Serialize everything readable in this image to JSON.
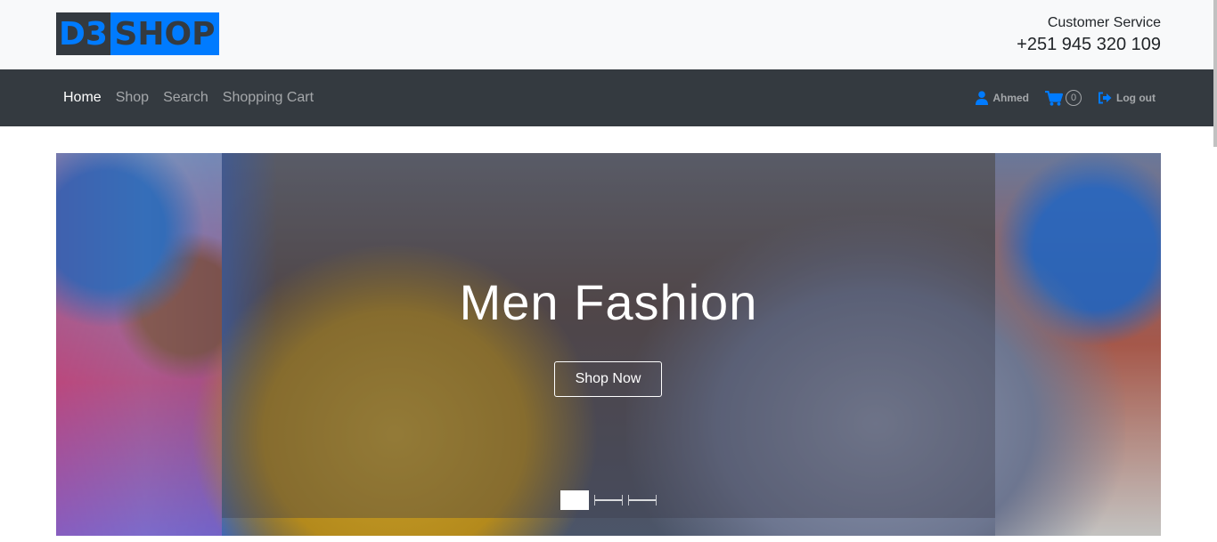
{
  "header": {
    "logo_left": "D3",
    "logo_right": "SHOP",
    "customer_service_label": "Customer Service",
    "customer_service_phone": "+251 945 320 109"
  },
  "nav": {
    "links": [
      "Home",
      "Shop",
      "Search",
      "Shopping Cart"
    ],
    "active": "Home",
    "user_name": "Ahmed",
    "cart_count": "0",
    "logout_label": "Log out"
  },
  "hero": {
    "title": "Men Fashion",
    "button_label": "Shop Now",
    "slide_count": 3,
    "active_slide": 1
  },
  "colors": {
    "brand_blue": "#007bff",
    "nav_dark": "#343a40",
    "header_bg": "#f8f9fa"
  },
  "icons": {
    "user": "user-icon",
    "cart": "shopping-cart-icon",
    "logout": "sign-out-icon"
  }
}
